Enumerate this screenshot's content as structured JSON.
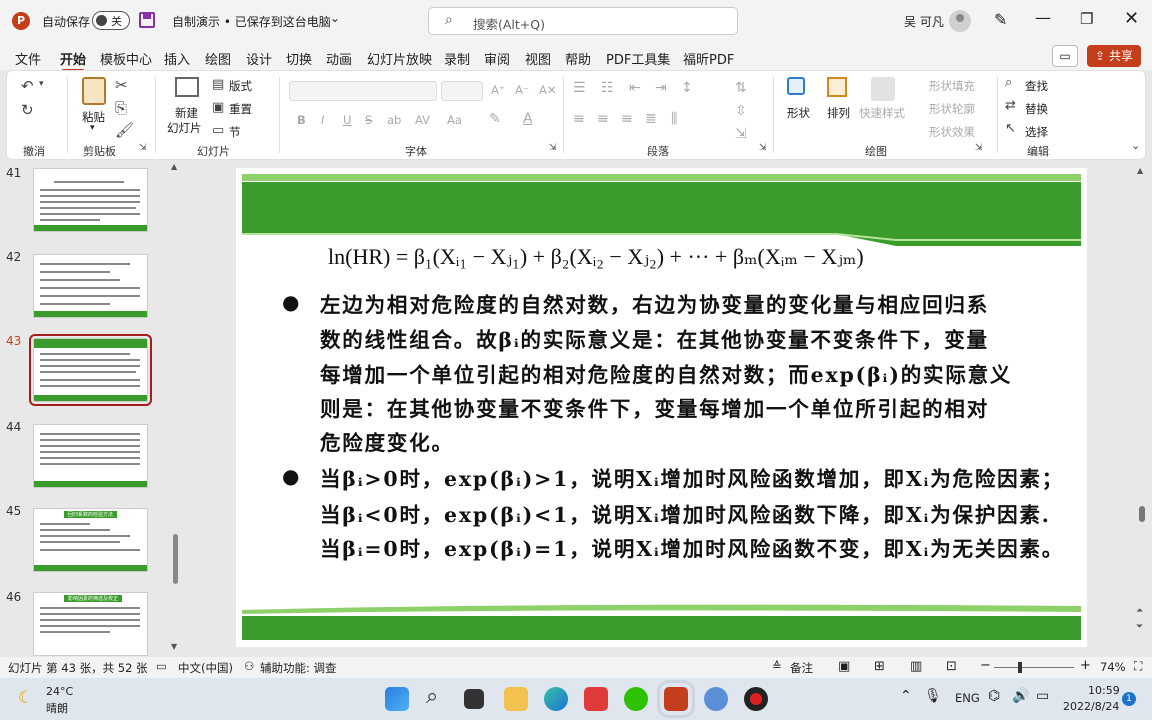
{
  "titlebar": {
    "autosave_label": "自动保存",
    "autosave_state": "关",
    "doc_title": "自制演示 • 已保存到这台电脑",
    "doc_title_caret": "⌄",
    "search_placeholder": "搜索(Alt+Q)",
    "user_name": "吴 可凡"
  },
  "menu": {
    "tabs": [
      "文件",
      "开始",
      "模板中心",
      "插入",
      "绘图",
      "设计",
      "切换",
      "动画",
      "幻灯片放映",
      "录制",
      "审阅",
      "视图",
      "帮助",
      "PDF工具集",
      "福昕PDF"
    ],
    "active": "开始",
    "share_label": "共享"
  },
  "ribbon": {
    "groups": {
      "undo": "撤消",
      "clipboard": "剪贴板",
      "slides": "幻灯片",
      "font": "字体",
      "paragraph": "段落",
      "drawing": "绘图",
      "editing": "编辑"
    },
    "paste": "粘贴",
    "new_slide": "新建",
    "new_slide_2": "幻灯片",
    "layout": "版式",
    "reset": "重置",
    "section": "节",
    "shape": "形状",
    "arrange": "排列",
    "quick_styles": "快速样式",
    "shape_fill": "形状填充",
    "shape_outline": "形状轮廓",
    "shape_effects": "形状效果",
    "find": "查找",
    "replace": "替换",
    "select": "选择",
    "font_buttons": [
      "B",
      "I",
      "U",
      "S",
      "ab",
      "AV",
      "Aa"
    ]
  },
  "thumbnails": [
    {
      "num": "41",
      "title": ""
    },
    {
      "num": "42",
      "title": ""
    },
    {
      "num": "43",
      "title": "",
      "selected": true
    },
    {
      "num": "44",
      "title": ""
    },
    {
      "num": "45",
      "title": "回归系数的检验方法"
    },
    {
      "num": "46",
      "title": "影响因素的筛选及校正"
    }
  ],
  "slide": {
    "formula": "ln(HR) = β₁(Xᵢ₁ − Xⱼ₁) + β₂(Xᵢ₂ − Xⱼ₂) + ··· + βₘ(Xᵢₘ − Xⱼₘ)",
    "bullet1_lines": [
      "左边为相对危险度的自然对数，右边为协变量的变化量与相应回归系",
      "数的线性组合。故βᵢ的实际意义是：在其他协变量不变条件下，变量",
      "每增加一个单位引起的相对危险度的自然对数；而exp(βᵢ)的实际意义",
      "则是：在其他协变量不变条件下，变量每增加一个单位所引起的相对",
      "危险度变化。"
    ],
    "bullet2_lines": [
      "当βᵢ>0时，exp(βᵢ)>1，说明Xᵢ增加时风险函数增加，即Xᵢ为危险因素；",
      "当βᵢ<0时，exp(βᵢ)<1，说明Xᵢ增加时风险函数下降，即Xᵢ为保护因素.",
      "当βᵢ=0时，exp(βᵢ)=1，说明Xᵢ增加时风险函数不变，即Xᵢ为无关因素。"
    ],
    "bullet_char": "●"
  },
  "status": {
    "slide_info": "幻灯片 第 43 张，共 52 张",
    "language": "中文(中国)",
    "accessibility": "辅助功能: 调查",
    "notes": "备注",
    "zoom": "74%"
  },
  "taskbar": {
    "weather_temp": "24°C",
    "weather_desc": "晴朗",
    "ime": "ENG",
    "time": "10:59",
    "date": "2022/8/24",
    "notif_count": "1"
  },
  "colors": {
    "accent": "#c43e1c",
    "slide_green": "#3a9c2a"
  }
}
